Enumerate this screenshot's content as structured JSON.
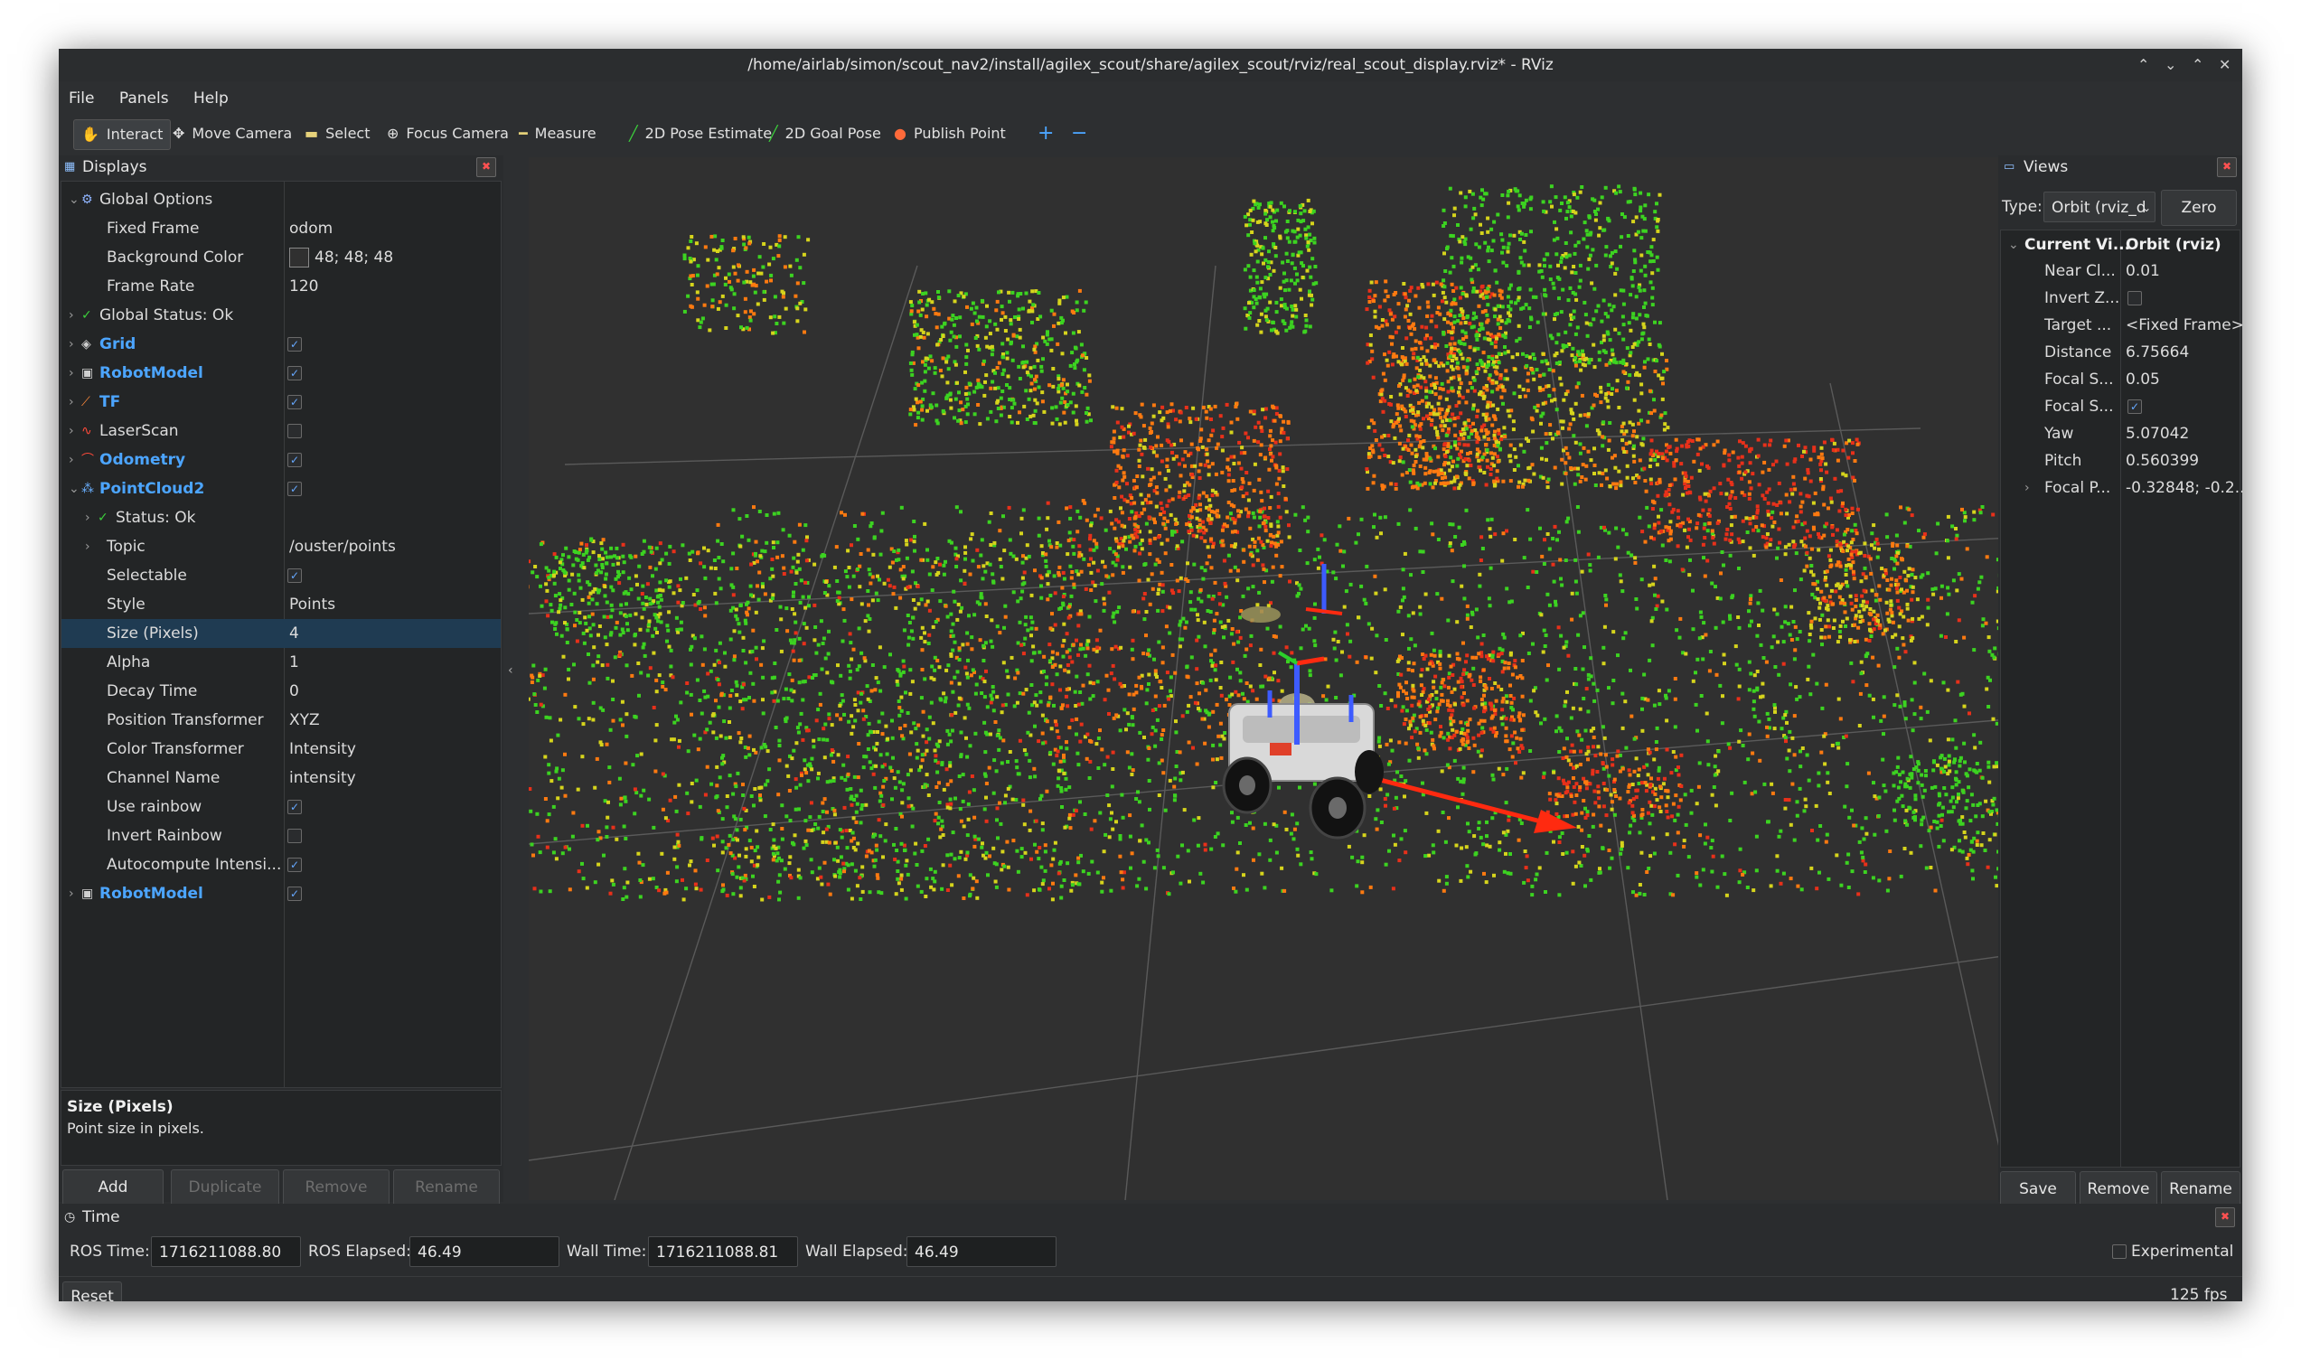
{
  "window": {
    "title": "/home/airlab/simon/scout_nav2/install/agilex_scout/share/agilex_scout/rviz/real_scout_display.rviz* - RViz",
    "controls": [
      "⌃",
      "⌄",
      "⌃",
      "✕"
    ]
  },
  "menu": [
    "File",
    "Panels",
    "Help"
  ],
  "toolbar": {
    "interact": "Interact",
    "move_camera": "Move Camera",
    "select": "Select",
    "focus_camera": "Focus Camera",
    "measure": "Measure",
    "pose_estimate": "2D Pose Estimate",
    "goal_pose": "2D Goal Pose",
    "publish_point": "Publish Point",
    "plus": "+",
    "minus": "−"
  },
  "displays": {
    "title": "Displays",
    "rows": [
      {
        "label": "Global Options",
        "value": "",
        "indent": 0,
        "expand": "v",
        "icon": "gear",
        "style": "normal"
      },
      {
        "label": "Fixed Frame",
        "value": "odom",
        "indent": 1,
        "expand": "",
        "icon": "",
        "style": "normal"
      },
      {
        "label": "Background Color",
        "value": "48; 48; 48",
        "indent": 1,
        "expand": "",
        "icon": "",
        "style": "color"
      },
      {
        "label": "Frame Rate",
        "value": "120",
        "indent": 1,
        "expand": "",
        "icon": "",
        "style": "normal"
      },
      {
        "label": "Global Status: Ok",
        "value": "",
        "indent": 0,
        "expand": ">",
        "icon": "check",
        "style": "normal"
      },
      {
        "label": "Grid",
        "value": "checked",
        "indent": 0,
        "expand": ">",
        "icon": "grid",
        "style": "blue"
      },
      {
        "label": "RobotModel",
        "value": "checked",
        "indent": 0,
        "expand": ">",
        "icon": "robot",
        "style": "blue"
      },
      {
        "label": "TF",
        "value": "checked",
        "indent": 0,
        "expand": ">",
        "icon": "tf",
        "style": "blue"
      },
      {
        "label": "LaserScan",
        "value": "unchecked",
        "indent": 0,
        "expand": ">",
        "icon": "laser",
        "style": "normal"
      },
      {
        "label": "Odometry",
        "value": "checked",
        "indent": 0,
        "expand": ">",
        "icon": "odom",
        "style": "blue"
      },
      {
        "label": "PointCloud2",
        "value": "checked",
        "indent": 0,
        "expand": "v",
        "icon": "cloud",
        "style": "blue"
      },
      {
        "label": "Status: Ok",
        "value": "",
        "indent": 1,
        "expand": ">",
        "icon": "check",
        "style": "normal"
      },
      {
        "label": "Topic",
        "value": "/ouster/points",
        "indent": 1,
        "expand": ">",
        "icon": "",
        "style": "normal"
      },
      {
        "label": "Selectable",
        "value": "checked",
        "indent": 1,
        "expand": "",
        "icon": "",
        "style": "normal"
      },
      {
        "label": "Style",
        "value": "Points",
        "indent": 1,
        "expand": "",
        "icon": "",
        "style": "normal"
      },
      {
        "label": "Size (Pixels)",
        "value": "4",
        "indent": 1,
        "expand": "",
        "icon": "",
        "style": "selected"
      },
      {
        "label": "Alpha",
        "value": "1",
        "indent": 1,
        "expand": "",
        "icon": "",
        "style": "normal"
      },
      {
        "label": "Decay Time",
        "value": "0",
        "indent": 1,
        "expand": "",
        "icon": "",
        "style": "normal"
      },
      {
        "label": "Position Transformer",
        "value": "XYZ",
        "indent": 1,
        "expand": "",
        "icon": "",
        "style": "normal"
      },
      {
        "label": "Color Transformer",
        "value": "Intensity",
        "indent": 1,
        "expand": "",
        "icon": "",
        "style": "normal"
      },
      {
        "label": "Channel Name",
        "value": "intensity",
        "indent": 1,
        "expand": "",
        "icon": "",
        "style": "normal"
      },
      {
        "label": "Use rainbow",
        "value": "checked",
        "indent": 1,
        "expand": "",
        "icon": "",
        "style": "normal"
      },
      {
        "label": "Invert Rainbow",
        "value": "unchecked",
        "indent": 1,
        "expand": "",
        "icon": "",
        "style": "normal"
      },
      {
        "label": "Autocompute Intensi...",
        "value": "checked",
        "indent": 1,
        "expand": "",
        "icon": "",
        "style": "normal"
      },
      {
        "label": "RobotModel",
        "value": "checked",
        "indent": 0,
        "expand": ">",
        "icon": "robot",
        "style": "blue"
      }
    ],
    "description_title": "Size (Pixels)",
    "description_text": "Point size in pixels.",
    "buttons": {
      "add": "Add",
      "duplicate": "Duplicate",
      "remove": "Remove",
      "rename": "Rename"
    }
  },
  "views": {
    "title": "Views",
    "type_label": "Type:",
    "type_value": "Orbit (rviz_d",
    "zero": "Zero",
    "header_name": "Current Vi...",
    "header_value": "Orbit (rviz)",
    "rows": [
      {
        "label": "Near Cl...",
        "value": "0.01",
        "check": false
      },
      {
        "label": "Invert Z...",
        "value": "unchecked",
        "check": true
      },
      {
        "label": "Target ...",
        "value": "<Fixed Frame>",
        "check": false
      },
      {
        "label": "Distance",
        "value": "6.75664",
        "check": false
      },
      {
        "label": "Focal S...",
        "value": "0.05",
        "check": false
      },
      {
        "label": "Focal S...",
        "value": "checked",
        "check": true
      },
      {
        "label": "Yaw",
        "value": "5.07042",
        "check": false
      },
      {
        "label": "Pitch",
        "value": "0.560399",
        "check": false
      },
      {
        "label": "Focal P...",
        "value": "-0.32848; -0.2...",
        "check": false
      }
    ],
    "buttons": {
      "save": "Save",
      "remove": "Remove",
      "rename": "Rename"
    }
  },
  "time": {
    "title": "Time",
    "ros_time_label": "ROS Time:",
    "ros_time": "1716211088.80",
    "ros_elapsed_label": "ROS Elapsed:",
    "ros_elapsed": "46.49",
    "wall_time_label": "Wall Time:",
    "wall_time": "1716211088.81",
    "wall_elapsed_label": "Wall Elapsed:",
    "wall_elapsed": "46.49",
    "experimental": "Experimental",
    "reset": "Reset",
    "fps": "125 fps"
  },
  "colors": {
    "background": "#303030",
    "selection": "#1f3b52",
    "link_blue": "#4ca5ff",
    "points_green": "#3cd321",
    "points_yellow": "#d6d41c",
    "points_orange": "#ff7a10",
    "points_red": "#e8301a"
  }
}
